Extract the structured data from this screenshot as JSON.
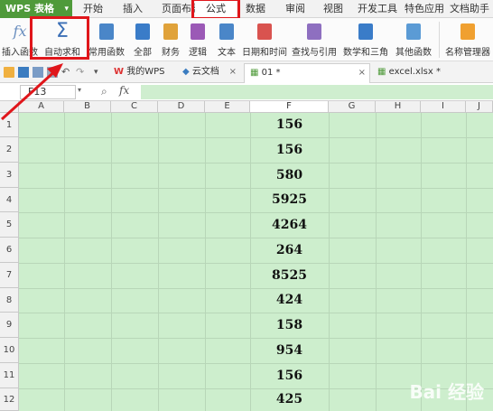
{
  "menubar": {
    "app_label": "WPS 表格",
    "tabs": [
      "开始",
      "插入",
      "页面布局",
      "公式",
      "数据",
      "审阅",
      "视图",
      "开发工具",
      "特色应用",
      "文档助手"
    ],
    "active_tab": "公式"
  },
  "ribbon": {
    "insert_function": "插入函数",
    "autosum": "自动求和",
    "common_functions": "常用函数",
    "all": "全部",
    "finance": "财务",
    "logic": "逻辑",
    "text": "文本",
    "datetime": "日期和时间",
    "lookup": "查找与引用",
    "math": "数学和三角",
    "other": "其他函数",
    "name_manager": "名称管理器"
  },
  "doctabs": [
    {
      "label": "我的WPS"
    },
    {
      "label": "云文档"
    },
    {
      "label": "01 *"
    },
    {
      "label": "excel.xlsx *"
    }
  ],
  "formula_bar": {
    "name_box": "F13",
    "fx": "fx"
  },
  "columns": [
    "A",
    "B",
    "C",
    "D",
    "E",
    "F",
    "G",
    "H",
    "I",
    "J"
  ],
  "rows": [
    "1",
    "2",
    "3",
    "4",
    "5",
    "6",
    "7",
    "8",
    "9",
    "10",
    "11",
    "12"
  ],
  "column_f_values": [
    "156",
    "156",
    "580",
    "5925",
    "4264",
    "264",
    "8525",
    "424",
    "158",
    "954",
    "156",
    "425"
  ],
  "watermark": "Bai 经验",
  "colors": {
    "accent_green": "#4f9a3a",
    "cell_green": "#cdeecd",
    "highlight_red": "#e0161b"
  }
}
